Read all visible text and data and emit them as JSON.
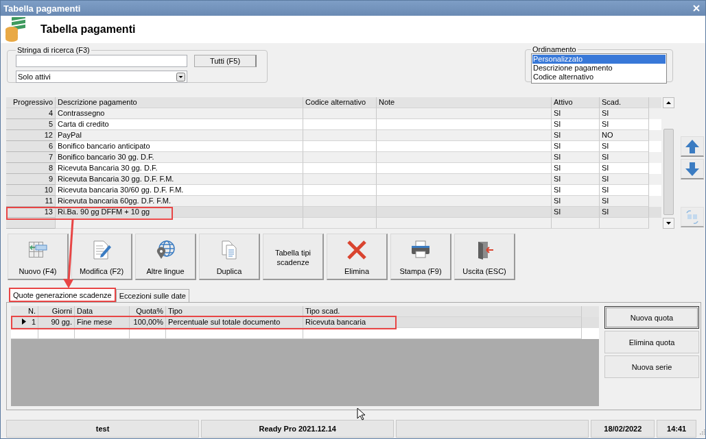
{
  "window": {
    "title": "Tabella pagamenti"
  },
  "header": {
    "title": "Tabella pagamenti"
  },
  "search": {
    "legend": "Stringa di ricerca (F3)",
    "button": "Tutti (F5)",
    "filter": "Solo attivi"
  },
  "ordering": {
    "legend": "Ordinamento",
    "items": [
      {
        "label": "Personalizzato",
        "selected": true
      },
      {
        "label": "Descrizione pagamento",
        "selected": false
      },
      {
        "label": "Codice alternativo",
        "selected": false
      }
    ]
  },
  "table": {
    "columns": [
      "Progressivo",
      "Descrizione pagamento",
      "Codice alternativo",
      "Note",
      "Attivo",
      "Scad."
    ],
    "rows": [
      {
        "progressivo": "4",
        "descrizione": "Contrassegno",
        "attivo": "SI",
        "scad": "SI",
        "selected": false
      },
      {
        "progressivo": "5",
        "descrizione": "Carta di credito",
        "attivo": "SI",
        "scad": "SI",
        "selected": false
      },
      {
        "progressivo": "12",
        "descrizione": "PayPal",
        "attivo": "SI",
        "scad": "NO",
        "selected": false
      },
      {
        "progressivo": "6",
        "descrizione": "Bonifico bancario anticipato",
        "attivo": "SI",
        "scad": "SI",
        "selected": false
      },
      {
        "progressivo": "7",
        "descrizione": "Bonifico bancario 30 gg. D.F.",
        "attivo": "SI",
        "scad": "SI",
        "selected": false
      },
      {
        "progressivo": "8",
        "descrizione": "Ricevuta Bancaria 30 gg. D.F.",
        "attivo": "SI",
        "scad": "SI",
        "selected": false
      },
      {
        "progressivo": "9",
        "descrizione": "Ricevuta Bancaria 30 gg. D.F. F.M.",
        "attivo": "SI",
        "scad": "SI",
        "selected": false
      },
      {
        "progressivo": "10",
        "descrizione": "Ricevuta bancaria 30/60 gg. D.F. F.M.",
        "attivo": "SI",
        "scad": "SI",
        "selected": false
      },
      {
        "progressivo": "11",
        "descrizione": "Ricevuta bancaria 60gg. D.F. F.M.",
        "attivo": "SI",
        "scad": "SI",
        "selected": false
      },
      {
        "progressivo": "13",
        "descrizione": "Ri.Ba. 90 gg DFFM + 10 gg",
        "attivo": "SI",
        "scad": "SI",
        "selected": true
      }
    ]
  },
  "toolbar": [
    {
      "kind": "new",
      "label": "Nuovo (F4)"
    },
    {
      "kind": "edit",
      "label": "Modifica (F2)"
    },
    {
      "kind": "globe",
      "label": "Altre lingue"
    },
    {
      "kind": "copy",
      "label": "Duplica"
    },
    {
      "kind": "text",
      "label": "Tabella tipi scadenze"
    },
    {
      "kind": "delete",
      "label": "Elimina"
    },
    {
      "kind": "print",
      "label": "Stampa (F9)"
    },
    {
      "kind": "exit",
      "label": "Uscita (ESC)"
    }
  ],
  "tabs": [
    {
      "label": "Quote generazione scadenze",
      "selected": true
    },
    {
      "label": "Eccezioni sulle date",
      "selected": false
    }
  ],
  "quote": {
    "columns": [
      "N.",
      "Giorni",
      "Data",
      "Quota%",
      "Tipo",
      "Tipo scad."
    ],
    "rows": [
      {
        "n": "1",
        "giorni": "90 gg.",
        "data": "Fine mese",
        "quota": "100,00%",
        "tipo": "Percentuale sul totale documento",
        "tipo_scad": "Ricevuta bancaria",
        "selected": true
      }
    ]
  },
  "side_buttons": [
    {
      "label": "Nuova quota",
      "focused": true
    },
    {
      "label": "Elimina quota",
      "focused": false
    },
    {
      "label": "Nuova serie",
      "focused": false
    }
  ],
  "status_bar": {
    "left": [
      "test",
      "Ready Pro 2021.12.14"
    ],
    "right": [
      "18/02/2022",
      "14:41"
    ]
  }
}
